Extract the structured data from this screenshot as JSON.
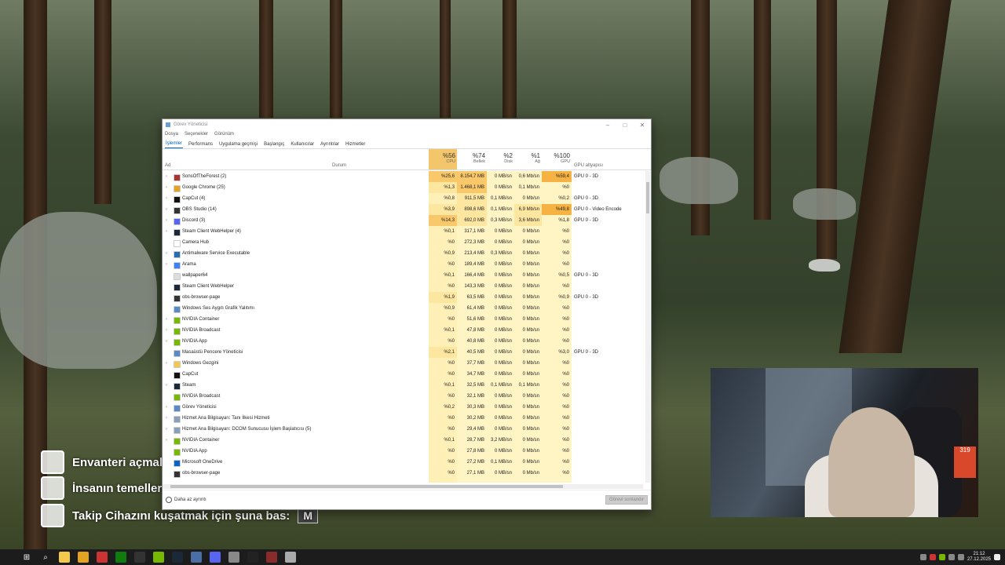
{
  "hud": {
    "line1": "Envanteri açmak",
    "line2": "İnsanın temelleri",
    "line3": "Takip Cihazını kuşatmak için şuna bas:",
    "line3_key": "M"
  },
  "task_manager": {
    "title": "Görev Yöneticisi",
    "menu": [
      "Dosya",
      "Seçenekler",
      "Görünüm"
    ],
    "tabs": [
      "İşlemler",
      "Performans",
      "Uygulama geçmişi",
      "Başlangıç",
      "Kullanıcılar",
      "Ayrıntılar",
      "Hizmetler"
    ],
    "active_tab": "İşlemler",
    "header": {
      "name": "Ad",
      "status": "Durum",
      "cpu_pct": "%56",
      "cpu": "CPU",
      "mem_pct": "%74",
      "mem": "Bellek",
      "disk_pct": "%2",
      "disk": "Disk",
      "net_pct": "%1",
      "net": "Ağ",
      "gpu_pct": "%100",
      "gpu": "GPU",
      "gpu_engine": "GPU altyapısı"
    },
    "rows": [
      {
        "name": "SonsOfTheForest (2)",
        "cpu": "%25,6",
        "mem": "8.154,7 MB",
        "disk": "0 MB/sn",
        "net": "0,6 Mb/sn",
        "gpu": "%59,4",
        "eng": "GPU 0 - 3D",
        "icon": "#a33",
        "exp": true
      },
      {
        "name": "Google Chrome (25)",
        "cpu": "%1,3",
        "mem": "1.468,1 MB",
        "disk": "0 MB/sn",
        "net": "0,1 Mb/sn",
        "gpu": "%0",
        "eng": "",
        "icon": "#e5a322",
        "exp": true
      },
      {
        "name": "CapCut (4)",
        "cpu": "%0,8",
        "mem": "911,5 MB",
        "disk": "0,1 MB/sn",
        "net": "0 Mb/sn",
        "gpu": "%0,2",
        "eng": "GPU 0 - 3D",
        "icon": "#111",
        "exp": true
      },
      {
        "name": "OBS Studio (14)",
        "cpu": "%3,9",
        "mem": "898,6 MB",
        "disk": "0,1 MB/sn",
        "net": "6,9 Mb/sn",
        "gpu": "%49,8",
        "eng": "GPU 0 - Video Encode",
        "icon": "#333",
        "exp": true
      },
      {
        "name": "Discord (3)",
        "cpu": "%14,3",
        "mem": "692,0 MB",
        "disk": "0,3 MB/sn",
        "net": "3,6 Mb/sn",
        "gpu": "%1,8",
        "eng": "GPU 0 - 3D",
        "icon": "#5865f2",
        "exp": true
      },
      {
        "name": "Steam Client WebHelper (4)",
        "cpu": "%0,1",
        "mem": "317,1 MB",
        "disk": "0 MB/sn",
        "net": "0 Mb/sn",
        "gpu": "%0",
        "eng": "",
        "icon": "#1b2838",
        "exp": true
      },
      {
        "name": "Camera Hub",
        "cpu": "%0",
        "mem": "272,3 MB",
        "disk": "0 MB/sn",
        "net": "0 Mb/sn",
        "gpu": "%0",
        "eng": "",
        "icon": "#fff",
        "exp": false
      },
      {
        "name": "Antimalware Service Executable",
        "cpu": "%0,9",
        "mem": "213,4 MB",
        "disk": "0,3 MB/sn",
        "net": "0 Mb/sn",
        "gpu": "%0",
        "eng": "",
        "icon": "#2b6cb0",
        "exp": true
      },
      {
        "name": "Arama",
        "cpu": "%0",
        "mem": "189,4 MB",
        "disk": "0 MB/sn",
        "net": "0 Mb/sn",
        "gpu": "%0",
        "eng": "",
        "icon": "#3b82f6",
        "exp": true
      },
      {
        "name": "wallpaper64",
        "cpu": "%0,1",
        "mem": "166,4 MB",
        "disk": "0 MB/sn",
        "net": "0 Mb/sn",
        "gpu": "%0,5",
        "eng": "GPU 0 - 3D",
        "icon": "#ddd",
        "exp": false
      },
      {
        "name": "Steam Client WebHelper",
        "cpu": "%0",
        "mem": "143,3 MB",
        "disk": "0 MB/sn",
        "net": "0 Mb/sn",
        "gpu": "%0",
        "eng": "",
        "icon": "#1b2838",
        "exp": false
      },
      {
        "name": "obs-browser-page",
        "cpu": "%1,9",
        "mem": "63,5 MB",
        "disk": "0 MB/sn",
        "net": "0 Mb/sn",
        "gpu": "%0,9",
        "eng": "GPU 0 - 3D",
        "icon": "#333",
        "exp": false
      },
      {
        "name": "Windows Ses Aygıtı Grafik Yalıtımı",
        "cpu": "%0,9",
        "mem": "61,4 MB",
        "disk": "0 MB/sn",
        "net": "0 Mb/sn",
        "gpu": "%0",
        "eng": "",
        "icon": "#5a8ac6",
        "exp": false
      },
      {
        "name": "NVIDIA Container",
        "cpu": "%0",
        "mem": "51,6 MB",
        "disk": "0 MB/sn",
        "net": "0 Mb/sn",
        "gpu": "%0",
        "eng": "",
        "icon": "#76b900",
        "exp": true
      },
      {
        "name": "NVIDIA Broadcast",
        "cpu": "%0,1",
        "mem": "47,8 MB",
        "disk": "0 MB/sn",
        "net": "0 Mb/sn",
        "gpu": "%0",
        "eng": "",
        "icon": "#76b900",
        "exp": true
      },
      {
        "name": "NVIDIA App",
        "cpu": "%0",
        "mem": "40,8 MB",
        "disk": "0 MB/sn",
        "net": "0 Mb/sn",
        "gpu": "%0",
        "eng": "",
        "icon": "#76b900",
        "exp": true
      },
      {
        "name": "Masaüstü Pencere Yöneticisi",
        "cpu": "%2,1",
        "mem": "40,5 MB",
        "disk": "0 MB/sn",
        "net": "0 Mb/sn",
        "gpu": "%3,0",
        "eng": "GPU 0 - 3D",
        "icon": "#5a8ac6",
        "exp": false
      },
      {
        "name": "Windows Gezgini",
        "cpu": "%0",
        "mem": "37,7 MB",
        "disk": "0 MB/sn",
        "net": "0 Mb/sn",
        "gpu": "%0",
        "eng": "",
        "icon": "#f2c94c",
        "exp": true
      },
      {
        "name": "CapCut",
        "cpu": "%0",
        "mem": "34,7 MB",
        "disk": "0 MB/sn",
        "net": "0 Mb/sn",
        "gpu": "%0",
        "eng": "",
        "icon": "#111",
        "exp": false
      },
      {
        "name": "Steam",
        "cpu": "%0,1",
        "mem": "32,5 MB",
        "disk": "0,1 MB/sn",
        "net": "0,1 Mb/sn",
        "gpu": "%0",
        "eng": "",
        "icon": "#1b2838",
        "exp": true
      },
      {
        "name": "NVIDIA Broadcast",
        "cpu": "%0",
        "mem": "32,1 MB",
        "disk": "0 MB/sn",
        "net": "0 Mb/sn",
        "gpu": "%0",
        "eng": "",
        "icon": "#76b900",
        "exp": false
      },
      {
        "name": "Görev Yöneticisi",
        "cpu": "%0,2",
        "mem": "30,3 MB",
        "disk": "0 MB/sn",
        "net": "0 Mb/sn",
        "gpu": "%0",
        "eng": "",
        "icon": "#5a8ac6",
        "exp": true
      },
      {
        "name": "Hizmet Ana Bilgisayarı: Tanı İlkesi Hizmeti",
        "cpu": "%0",
        "mem": "30,2 MB",
        "disk": "0 MB/sn",
        "net": "0 Mb/sn",
        "gpu": "%0",
        "eng": "",
        "icon": "#8aa0b8",
        "exp": true
      },
      {
        "name": "Hizmet Ana Bilgisayarı: DCOM Sunucusu İşlem Başlatıcısı (5)",
        "cpu": "%0",
        "mem": "29,4 MB",
        "disk": "0 MB/sn",
        "net": "0 Mb/sn",
        "gpu": "%0",
        "eng": "",
        "icon": "#8aa0b8",
        "exp": true
      },
      {
        "name": "NVIDIA Container",
        "cpu": "%0,1",
        "mem": "28,7 MB",
        "disk": "3,2 MB/sn",
        "net": "0 Mb/sn",
        "gpu": "%0",
        "eng": "",
        "icon": "#76b900",
        "exp": true
      },
      {
        "name": "NVIDIA App",
        "cpu": "%0",
        "mem": "27,8 MB",
        "disk": "0 MB/sn",
        "net": "0 Mb/sn",
        "gpu": "%0",
        "eng": "",
        "icon": "#76b900",
        "exp": false
      },
      {
        "name": "Microsoft OneDrive",
        "cpu": "%0",
        "mem": "27,2 MB",
        "disk": "0,1 MB/sn",
        "net": "0 Mb/sn",
        "gpu": "%0",
        "eng": "",
        "icon": "#0a66c2",
        "exp": false
      },
      {
        "name": "obs-browser-page",
        "cpu": "%0",
        "mem": "27,1 MB",
        "disk": "0 MB/sn",
        "net": "0 Mb/sn",
        "gpu": "%0",
        "eng": "",
        "icon": "#333",
        "exp": false
      }
    ],
    "footer_fewer": "Daha az ayrıntı",
    "footer_end": "Görevi sonlandır",
    "colors": {
      "cpu_hot": "#f7c76a",
      "cell": "#fff4c4",
      "active_tab": "#0063b1"
    }
  },
  "webcam": {
    "sign": "319"
  },
  "taskbar": {
    "icons": [
      "windows-icon",
      "search-icon",
      "file-explorer-icon",
      "chrome-icon",
      "capcut-icon",
      "xbox-icon",
      "obs-icon",
      "nvidia-icon",
      "steam-icon",
      "steam-helper-icon",
      "discord-icon",
      "files-icon",
      "terminal-icon",
      "sons-of-forest-icon",
      "notepad-icon"
    ],
    "time": "21:12",
    "date": "27.12.2025"
  }
}
